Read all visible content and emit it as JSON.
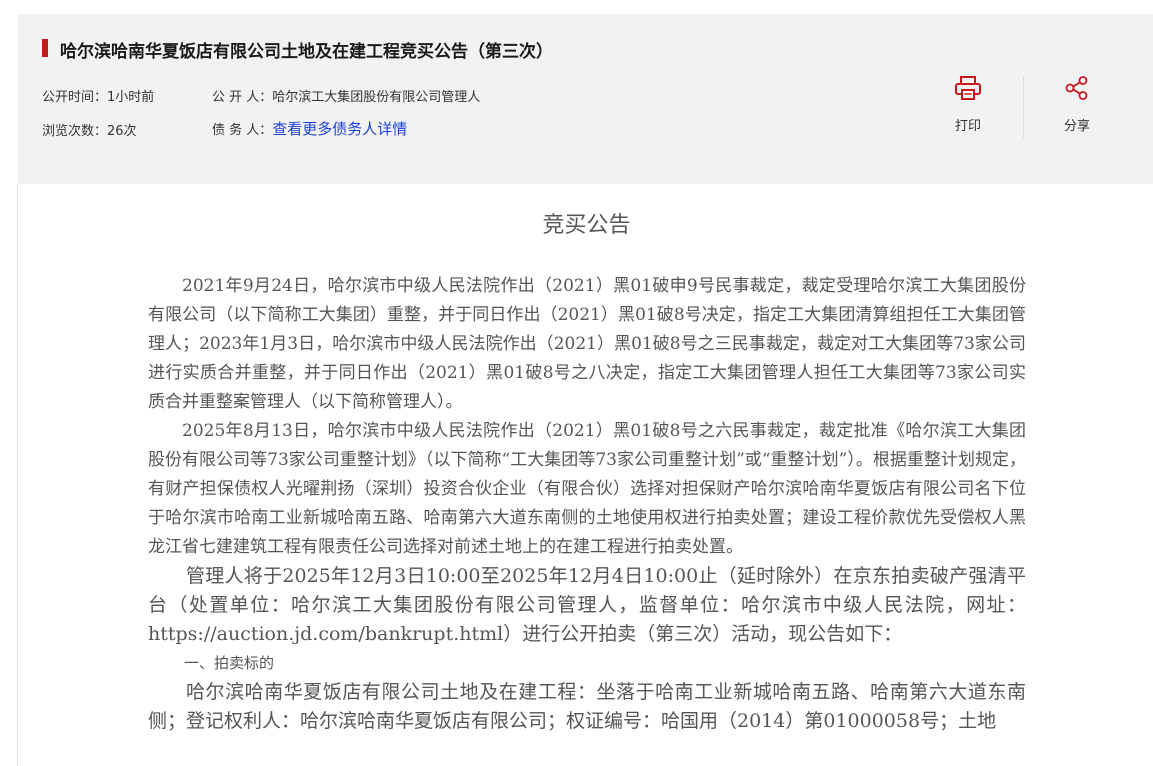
{
  "header": {
    "title": "哈尔滨哈南华夏饭店有限公司土地及在建工程竞买公告（第三次）",
    "publish_time_label": "公开时间：",
    "publish_time_value": "1小时前",
    "publisher_label": "公 开 人：",
    "publisher_value": "哈尔滨工大集团股份有限公司管理人",
    "views_label": "浏览次数：",
    "views_value": "26次",
    "debtor_label": "债 务 人：",
    "debtor_link": "查看更多债务人详情",
    "print_label": "打印",
    "share_label": "分享",
    "accent_color": "#c8161d"
  },
  "document": {
    "heading": "竞买公告",
    "paragraphs": [
      "2021年9月24日，哈尔滨市中级人民法院作出（2021）黑01破申9号民事裁定，裁定受理哈尔滨工大集团股份有限公司（以下简称工大集团）重整，并于同日作出（2021）黑01破8号决定，指定工大集团清算组担任工大集团管理人；2023年1月3日，哈尔滨市中级人民法院作出（2021）黑01破8号之三民事裁定，裁定对工大集团等73家公司进行实质合并重整，并于同日作出（2021）黑01破8号之八决定，指定工大集团管理人担任工大集团等73家公司实质合并重整案管理人（以下简称管理人）。",
      "2025年8月13日，哈尔滨市中级人民法院作出（2021）黑01破8号之六民事裁定，裁定批准《哈尔滨工大集团股份有限公司等73家公司重整计划》（以下简称“工大集团等73家公司重整计划”或“重整计划”）。根据重整计划规定，有财产担保债权人光曜荆扬（深圳）投资合伙企业（有限合伙）选择对担保财产哈尔滨哈南华夏饭店有限公司名下位于哈尔滨市哈南工业新城哈南五路、哈南第六大道东南侧的土地使用权进行拍卖处置；建设工程价款优先受偿权人黑龙江省七建建筑工程有限责任公司选择对前述土地上的在建工程进行拍卖处置。",
      "管理人将于2025年12月3日10:00至2025年12月4日10:00止（延时除外）在京东拍卖破产强清平台（处置单位：哈尔滨工大集团股份有限公司管理人，监督单位：哈尔滨市中级人民法院，网址：https://auction.jd.com/bankrupt.html）进行公开拍卖（第三次）活动，现公告如下：",
      "一、拍卖标的",
      "哈尔滨哈南华夏饭店有限公司土地及在建工程：坐落于哈南工业新城哈南五路、哈南第六大道东南侧；登记权利人：哈尔滨哈南华夏饭店有限公司；权证编号：哈国用（2014）第01000058号；土地"
    ]
  }
}
